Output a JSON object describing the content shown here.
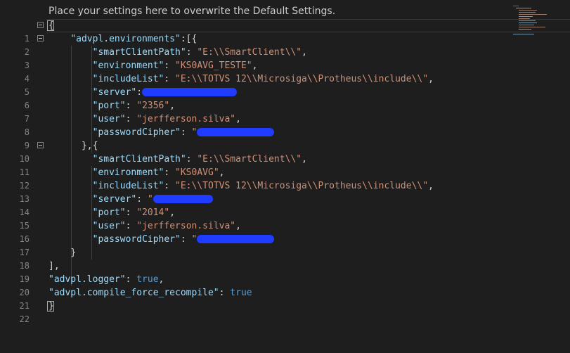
{
  "header": {
    "hint": "Place your settings here to overwrite the Default Settings."
  },
  "lines": {
    "n1": "1",
    "n2": "2",
    "n3": "3",
    "n4": "4",
    "n5": "5",
    "n6": "6",
    "n7": "7",
    "n8": "8",
    "n9": "9",
    "n10": "10",
    "n11": "11",
    "n12": "12",
    "n13": "13",
    "n14": "14",
    "n15": "15",
    "n16": "16",
    "n17": "17",
    "n18": "18",
    "n19": "19",
    "n20": "20",
    "n21": "21",
    "n22": "22"
  },
  "code": {
    "l1": "{",
    "l2_key": "\"advpl.environments\"",
    "l2_rest": ":[{",
    "l3_key": "\"smartClientPath\"",
    "l3_val": "\"E:\\\\SmartClient\\\\\"",
    "l4_key": "\"environment\"",
    "l4_val": "\"KS0AVG_TESTE\"",
    "l5_key": "\"includeList\"",
    "l5_val": "\"E:\\\\TOTVS 12\\\\Microsiga\\\\Protheus\\\\include\\\\\"",
    "l6_key": "\"server\"",
    "l7_key": "\"port\"",
    "l7_val": "\"2356\"",
    "l8_key": "\"user\"",
    "l8_val": "\"jerfferson.silva\"",
    "l9_key": "\"passwordCipher\"",
    "l9_val": "\"",
    "l10": "},{",
    "l11_key": "\"smartClientPath\"",
    "l11_val": "\"E:\\\\SmartClient\\\\\"",
    "l12_key": "\"environment\"",
    "l12_val": "\"KS0AVG\"",
    "l13_key": "\"includeList\"",
    "l13_val": "\"E:\\\\TOTVS 12\\\\Microsiga\\\\Protheus\\\\include\\\\\"",
    "l14_key": "\"server\"",
    "l14_val": "\"",
    "l15_key": "\"port\"",
    "l15_val": "\"2014\"",
    "l16_key": "\"user\"",
    "l16_val": "\"jerfferson.silva\"",
    "l17_key": "\"passwordCipher\"",
    "l17_val": "\"",
    "l18": "}",
    "l19": "],",
    "l20_key": "\"advpl.logger\"",
    "l20_val": "true",
    "l21_key": "\"advpl.compile_force_recompile\"",
    "l21_val": "true",
    "l22": "}"
  },
  "colors": {
    "background": "#1e1e1e",
    "key": "#9cdcfe",
    "string": "#ce9178",
    "boolean": "#569cd6",
    "redaction": "#1f3cff"
  }
}
